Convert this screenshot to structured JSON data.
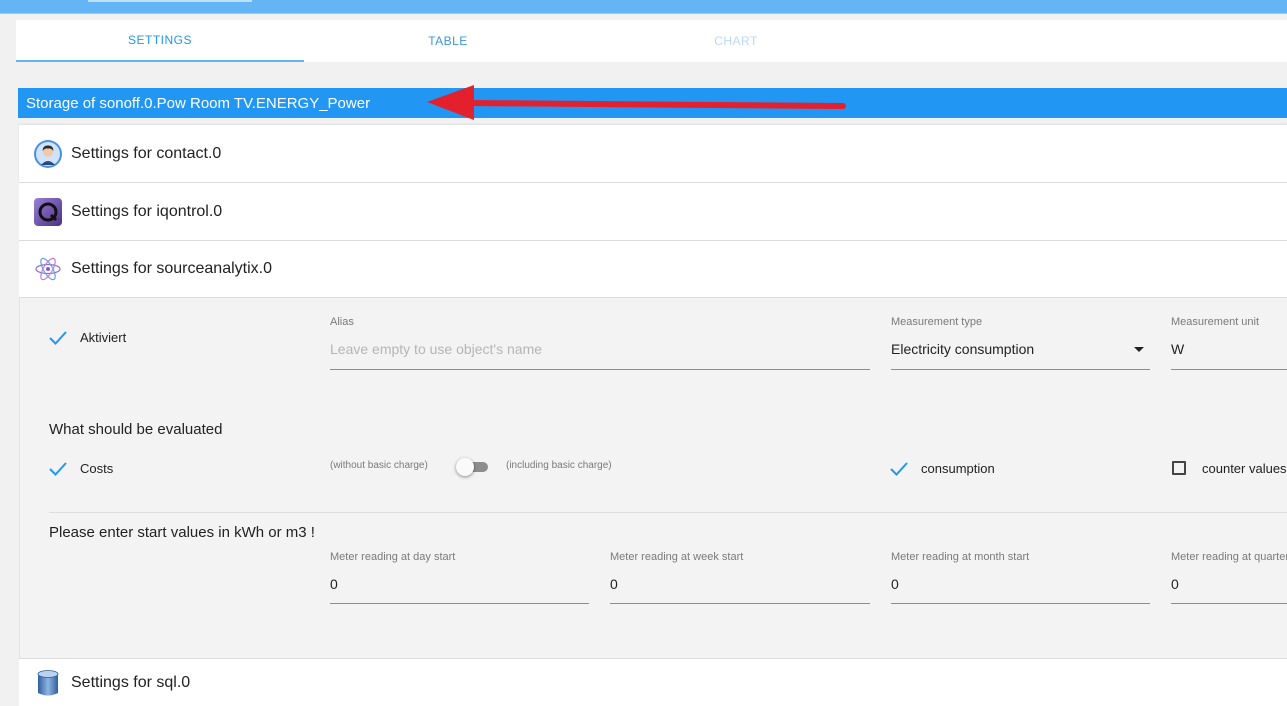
{
  "tabs": [
    {
      "label": "SETTINGS",
      "active": true
    },
    {
      "label": "TABLE",
      "active": false
    },
    {
      "label": "CHART",
      "active": false
    }
  ],
  "storage_title": "Storage of sonoff.0.Pow Room TV.ENERGY_Power",
  "panels": {
    "contact": "Settings for contact.0",
    "iqontrol": "Settings for iqontrol.0",
    "sourceanalytix": "Settings for sourceanalytix.0",
    "sql": "Settings for sql.0"
  },
  "form": {
    "activated_label": "Aktiviert",
    "alias_label": "Alias",
    "alias_placeholder": "Leave empty to use object's name",
    "measurement_type_label": "Measurement type",
    "measurement_type_value": "Electricity consumption",
    "measurement_unit_label": "Measurement unit",
    "measurement_unit_value": "W",
    "evaluate_heading": "What should be evaluated",
    "costs_label": "Costs",
    "without_basic_charge": "(without basic charge)",
    "including_basic_charge": "(including basic charge)",
    "consumption_label": "consumption",
    "counter_values_label": "counter values",
    "start_values_heading": "Please enter start values in kWh or m3 !",
    "meter_day_label": "Meter reading at day start",
    "meter_day_value": "0",
    "meter_week_label": "Meter reading at week start",
    "meter_week_value": "0",
    "meter_month_label": "Meter reading at month start",
    "meter_month_value": "0",
    "meter_quarter_label": "Meter reading at quarter start",
    "meter_quarter_value": "0"
  },
  "colors": {
    "accent": "#2196f3",
    "topbar": "#64b5f6",
    "arrow": "#e3202b"
  }
}
